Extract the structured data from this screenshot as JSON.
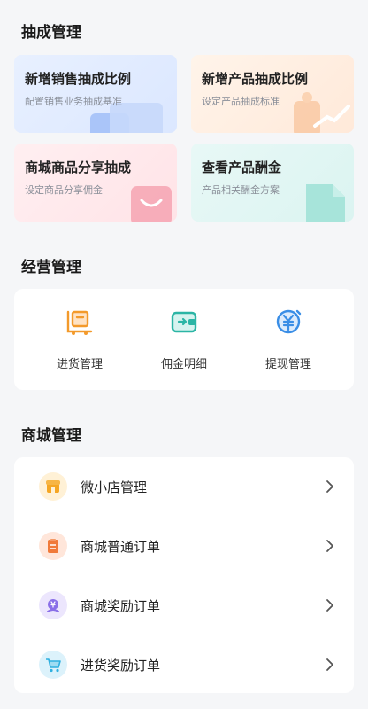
{
  "commission": {
    "title": "抽成管理",
    "cards": [
      {
        "title": "新增销售抽成比例",
        "subtitle": "配置销售业务抽成基准"
      },
      {
        "title": "新增产品抽成比例",
        "subtitle": "设定产品抽成标准"
      },
      {
        "title": "商城商品分享抽成",
        "subtitle": "设定商品分享佣金"
      },
      {
        "title": "查看产品酬金",
        "subtitle": "产品相关酬金方案"
      }
    ]
  },
  "business": {
    "title": "经营管理",
    "items": [
      {
        "label": "进货管理",
        "icon": "warehouse-icon",
        "color": "#f39a2b"
      },
      {
        "label": "佣金明细",
        "icon": "wallet-icon",
        "color": "#2bb5a5"
      },
      {
        "label": "提现管理",
        "icon": "yuan-icon",
        "color": "#3a8ee6"
      }
    ]
  },
  "mall": {
    "title": "商城管理",
    "items": [
      {
        "label": "微小店管理",
        "icon": "store-icon",
        "color": "#f5a623"
      },
      {
        "label": "商城普通订单",
        "icon": "clipboard-icon",
        "color": "#f07a3a"
      },
      {
        "label": "商城奖励订单",
        "icon": "reward-icon",
        "color": "#8a6fe8"
      },
      {
        "label": "进货奖励订单",
        "icon": "cart-icon",
        "color": "#2fb0e0"
      }
    ]
  }
}
